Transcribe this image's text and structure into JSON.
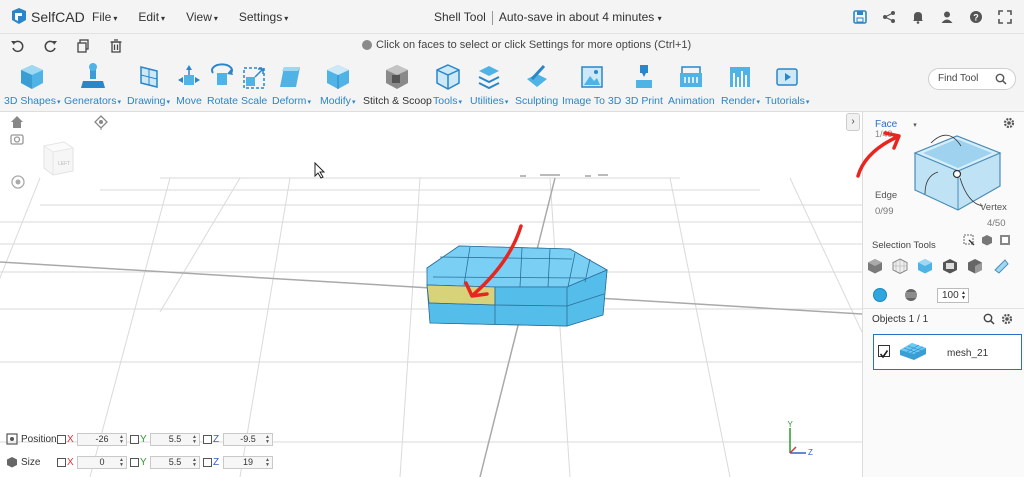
{
  "app": {
    "logo_text": "SelfCAD",
    "menus": [
      "File",
      "Edit",
      "View",
      "Settings"
    ],
    "tool_name": "Shell Tool",
    "autosave": "Auto-save in about 4 minutes",
    "hint": "Click on faces to select or click Settings for more options (Ctrl+1)"
  },
  "toolbar": {
    "items": [
      {
        "label": "3D Shapes",
        "dropdown": true
      },
      {
        "label": "Generators",
        "dropdown": true
      },
      {
        "label": "Drawing",
        "dropdown": true
      },
      {
        "label": "Move",
        "dropdown": false
      },
      {
        "label": "Rotate",
        "dropdown": false
      },
      {
        "label": "Scale",
        "dropdown": false
      },
      {
        "label": "Deform",
        "dropdown": true
      },
      {
        "label": "Modify",
        "dropdown": true
      },
      {
        "label": "Stitch & Scoop",
        "dropdown": false,
        "active": true
      },
      {
        "label": "Tools",
        "dropdown": true
      },
      {
        "label": "Utilities",
        "dropdown": true
      },
      {
        "label": "Sculpting",
        "dropdown": false
      },
      {
        "label": "Image To 3D",
        "dropdown": false
      },
      {
        "label": "3D Print",
        "dropdown": false
      },
      {
        "label": "Animation",
        "dropdown": false
      },
      {
        "label": "Render",
        "dropdown": true
      },
      {
        "label": "Tutorials",
        "dropdown": true
      }
    ],
    "find_placeholder": "Find Tool"
  },
  "viewport": {
    "nav_cube_label": "LEFT",
    "transform": {
      "position": {
        "label": "Position",
        "x": "-26",
        "y": "5.5",
        "z": "-9.5"
      },
      "size": {
        "label": "Size",
        "x": "0",
        "y": "5.5",
        "z": "19"
      },
      "axis_x": "X",
      "axis_y": "Y",
      "axis_z": "Z"
    },
    "gizmo": {
      "y": "Y",
      "z": "Z"
    }
  },
  "panel": {
    "face": {
      "label": "Face",
      "count": "1/49"
    },
    "edge": {
      "label": "Edge",
      "count": "0/99"
    },
    "vertex": {
      "label": "Vertex",
      "count": "4/50"
    },
    "selection_tools_title": "Selection Tools",
    "opacity": "100",
    "objects": {
      "title": "Objects 1 / 1",
      "items": [
        {
          "name": "mesh_21",
          "checked": true
        }
      ]
    }
  },
  "colors": {
    "accent": "#2a86c9",
    "mesh": "#5ec4f0",
    "selected_face": "#d8d27a",
    "annotation": "#e8261f"
  }
}
